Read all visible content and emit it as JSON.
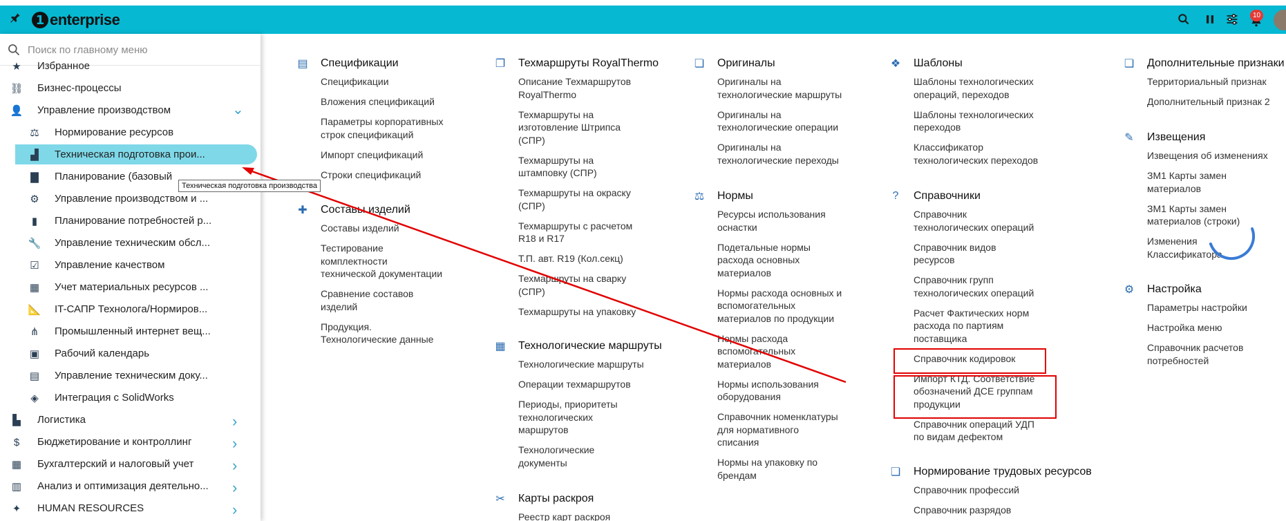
{
  "app": {
    "brand": "enterprise",
    "notification_count": "10"
  },
  "search": {
    "placeholder": "Поиск по главному меню"
  },
  "sidebar": {
    "tooltip": "Техническая подготовка производства",
    "items": [
      {
        "label": "Избранное",
        "icon": "star-icon"
      },
      {
        "label": "Бизнес-процессы",
        "icon": "process-icon"
      },
      {
        "label": "Управление производством",
        "icon": "worker-icon"
      },
      {
        "label": "Нормирование ресурсов",
        "icon": "scales-icon"
      },
      {
        "label": "Техническая подготовка прои...",
        "icon": "factory-icon"
      },
      {
        "label": "Планирование (базовый",
        "icon": "bar-chart-icon"
      },
      {
        "label": "Управление производством и ...",
        "icon": "gear-icon"
      },
      {
        "label": "Планирование потребностей р...",
        "icon": "bottle-icon"
      },
      {
        "label": "Управление техническим обсл...",
        "icon": "wrench-icon"
      },
      {
        "label": "Управление качеством",
        "icon": "checkbox-icon"
      },
      {
        "label": "Учет материальных ресурсов ...",
        "icon": "calculator-grid-icon"
      },
      {
        "label": "IT-САПР Технолога/Нормиров...",
        "icon": "ruler-icon"
      },
      {
        "label": "Промышленный интернет вещ...",
        "icon": "network-icon"
      },
      {
        "label": "Рабочий календарь",
        "icon": "calendar-icon"
      },
      {
        "label": "Управление техническим доку...",
        "icon": "document-icon"
      },
      {
        "label": "Интеграция с SolidWorks",
        "icon": "solidworks-icon"
      },
      {
        "label": "Логистика",
        "icon": "file-icon"
      },
      {
        "label": "Бюджетирование и контроллинг",
        "icon": "dollar-icon"
      },
      {
        "label": "Бухгалтерский и налоговый учет",
        "icon": "calculator-icon"
      },
      {
        "label": "Анализ и оптимизация деятельно...",
        "icon": "analytics-icon"
      },
      {
        "label": "HUMAN RESOURCES",
        "icon": "people-icon"
      }
    ]
  },
  "columns": [
    {
      "sections": [
        {
          "title": "Спецификации",
          "icon": "document-icon",
          "links": [
            "Спецификации",
            "Вложения спецификаций",
            "Параметры корпоративных\nстрок спецификаций",
            "Импорт спецификаций",
            "Строки спецификаций"
          ]
        },
        {
          "title": "Составы изделий",
          "icon": "puzzle-icon",
          "links": [
            "Составы изделий",
            "Тестирование\nкомплектности\nтехнической документации",
            "Сравнение составов\nизделий",
            "Продукция.\nТехнологические данные"
          ]
        }
      ]
    },
    {
      "sections": [
        {
          "title": "Техмаршруты RoyalThermo",
          "icon": "pages-icon",
          "links": [
            "Описание Техмаршрутов\nRoyalThermo",
            "Техмаршруты на\nизготовление Штрипса\n(СПР)",
            "Техмаршруты на\nштамповку (СПР)",
            "Техмаршруты на окраску\n(СПР)",
            "Техмаршруты с расчетом\nR18 и R17",
            "Т.П. авт. R19 (Кол.секц)",
            "Техмаршруты на сварку\n(СПР)",
            "Техмаршруты на упаковку"
          ]
        },
        {
          "title": "Технологические маршруты",
          "icon": "building-icon",
          "links": [
            "Технологические маршруты",
            "Операции техмаршрутов",
            "Периоды, приоритеты\nтехнологических\nмаршрутов",
            "Технологические\nдокументы"
          ]
        },
        {
          "title": "Карты раскроя",
          "icon": "scissors-icon",
          "links": [
            "Реестр карт раскроя"
          ]
        }
      ]
    },
    {
      "sections": [
        {
          "title": "Оригиналы",
          "icon": "folder-icon",
          "links": [
            "Оригиналы на\nтехнологические маршруты",
            "Оригиналы на\nтехнологические операции",
            "Оригиналы на\nтехнологические переходы"
          ]
        },
        {
          "title": "Нормы",
          "icon": "scales-icon",
          "links": [
            "Ресурсы использования\nоснастки",
            "Подетальные нормы\nрасхода основных\nматериалов",
            "Нормы расхода основных и\nвспомогательных\nматериалов по продукции",
            "Нормы расхода\nвспомогательных\nматериалов",
            "Нормы использования\nоборудования",
            "Справочник номенклатуры\nдля нормативного\nсписания",
            "Нормы на упаковку по\nбрендам"
          ]
        }
      ]
    },
    {
      "sections": [
        {
          "title": "Шаблоны",
          "icon": "cubes-icon",
          "links": [
            "Шаблоны технологических\nопераций, переходов",
            "Шаблоны технологических\nпереходов",
            "Классификатор\nтехнологических переходов"
          ]
        },
        {
          "title": "Справочники",
          "icon": "help-book-icon",
          "links": [
            "Справочник\nтехнологических операций",
            "Справочник видов\nресурсов",
            "Справочник групп\nтехнологических операций",
            "Расчет Фактических норм\nрасхода по партиям\nпоставщика",
            "Справочник кодировок",
            "Импорт КТД. Соответствие\nобозначений ДСЕ группам\nпродукции",
            "Справочник операций УДП\nпо видам дефектом"
          ]
        },
        {
          "title": "Нормирование трудовых ресурсов",
          "icon": "folder-icon",
          "links": [
            "Справочник профессий",
            "Справочник разрядов"
          ]
        }
      ]
    },
    {
      "sections": [
        {
          "title": "Дополнительные признаки",
          "icon": "folder-icon",
          "links": [
            "Территориальный признак",
            "Дополнительный признак 2"
          ]
        },
        {
          "title": "Извещения",
          "icon": "edit-doc-icon",
          "links": [
            "Извещения об изменениях",
            "ЗМ1 Карты замен\nматериалов",
            "ЗМ1 Карты замен\nматериалов (строки)",
            "Изменения\nКлассификатора"
          ]
        },
        {
          "title": "Настройка",
          "icon": "gears-icon",
          "links": [
            "Параметры настройки",
            "Настройка меню",
            "Справочник расчетов\nпотребностей"
          ]
        }
      ]
    }
  ],
  "colors": {
    "topbar": "#06b8d2",
    "active_item": "#7ed8e8",
    "annotation": "#e20000",
    "icon_blue": "#2b6cb0"
  }
}
